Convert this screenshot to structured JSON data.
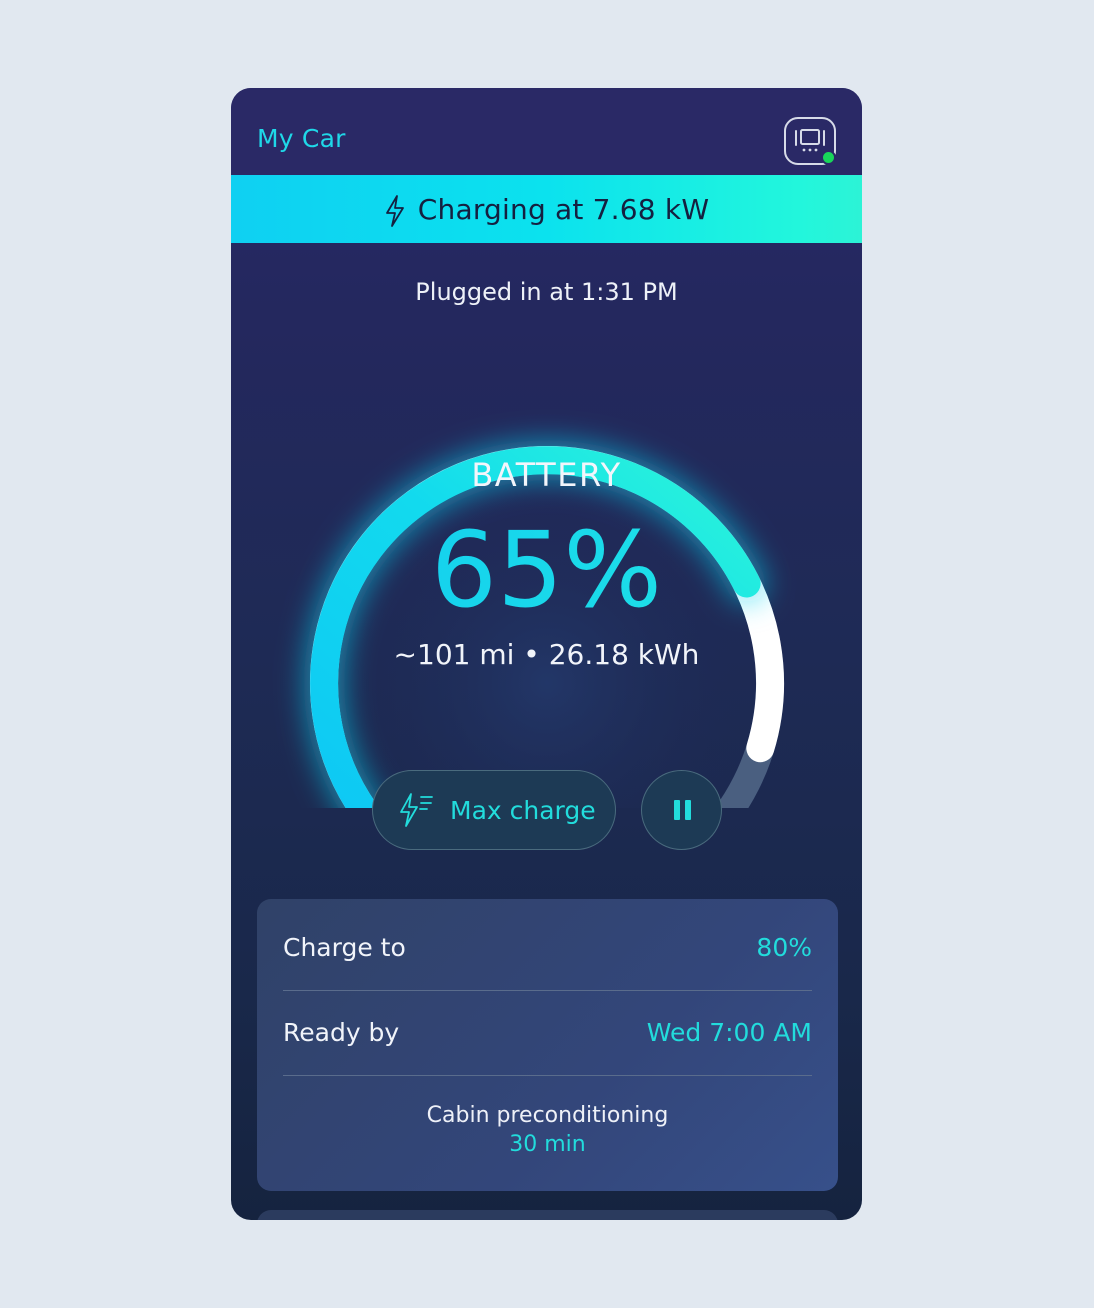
{
  "header": {
    "title": "My Car",
    "device_icon": "charger-station-icon",
    "status_color": "#18d65a"
  },
  "banner": {
    "icon": "lightning-bolt-icon",
    "text": "Charging at 7.68 kW"
  },
  "session": {
    "plugged_in": "Plugged in at 1:31 PM"
  },
  "battery": {
    "label": "BATTERY",
    "percent": 65,
    "percent_text": "65%",
    "target_percent": 80,
    "range_energy": "~101 mi • 26.18 kWh"
  },
  "actions": {
    "max_charge_icon": "fast-charge-icon",
    "max_charge_label": "Max charge",
    "pause_icon": "pause-icon"
  },
  "settings": {
    "charge_to_label": "Charge to",
    "charge_to_value": "80%",
    "ready_by_label": "Ready by",
    "ready_by_value": "Wed 7:00 AM",
    "preconditioning_label": "Cabin preconditioning",
    "preconditioning_value": "30 min"
  },
  "colors": {
    "accent": "#1fd8e8",
    "banner_start": "#0fd0f2",
    "banner_end": "#2cf3d6",
    "background": "#1e2a55"
  }
}
